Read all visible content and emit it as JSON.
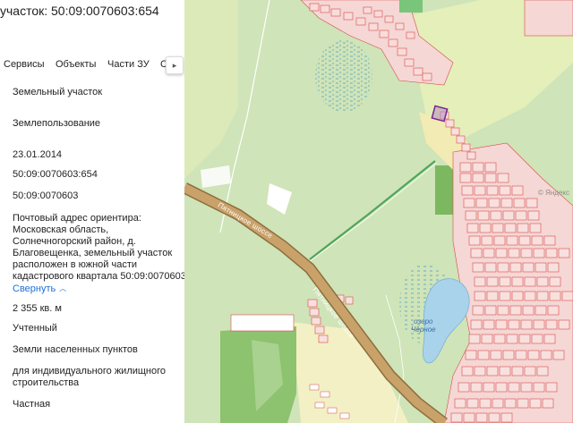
{
  "panel": {
    "title": "участок: 50:09:0070603:654",
    "tabs": [
      {
        "label": "Сервисы"
      },
      {
        "label": "Объекты"
      },
      {
        "label": "Части ЗУ"
      },
      {
        "label": "С"
      }
    ],
    "tab_scroll_icon": "chevron-right-icon",
    "fields": {
      "object_type": "Земельный участок",
      "category": "Землепользование",
      "date": "23.01.2014",
      "cadastral_number": "50:09:0070603:654",
      "cadastral_quarter": "50:09:0070603",
      "address_lines": [
        "Почтовый адрес ориентира:",
        "Московская область,",
        "Солнечногорский район, д.",
        "Благовещенка, земельный участок",
        "расположен в южной части",
        "кадастрового квартала 50:09:0070603"
      ],
      "collapse_label": "Свернуть",
      "area": "2 355 кв. м",
      "status": "Учтенный",
      "land_category": "Земли населенных пунктов",
      "permitted_use_lines": [
        "для индивидуального жилищного",
        "строительства"
      ],
      "ownership": "Частная"
    }
  },
  "map": {
    "road_label": "Пятницкое шоссе",
    "lake_label_lines": [
      "озеро",
      "Чёрное"
    ],
    "copyright": "© Яндекс",
    "colors": {
      "forest": "#cfe4b8",
      "field": "#e4efb9",
      "dark_forest": "#8dc26e",
      "settlement": "#f5d7d5",
      "parcel_outline": "#d84b4b",
      "road": "#c9a26a",
      "road_edge": "#8e6d3e",
      "water": "#a9d3ea",
      "selected_parcel": "#7b2d8f"
    }
  }
}
